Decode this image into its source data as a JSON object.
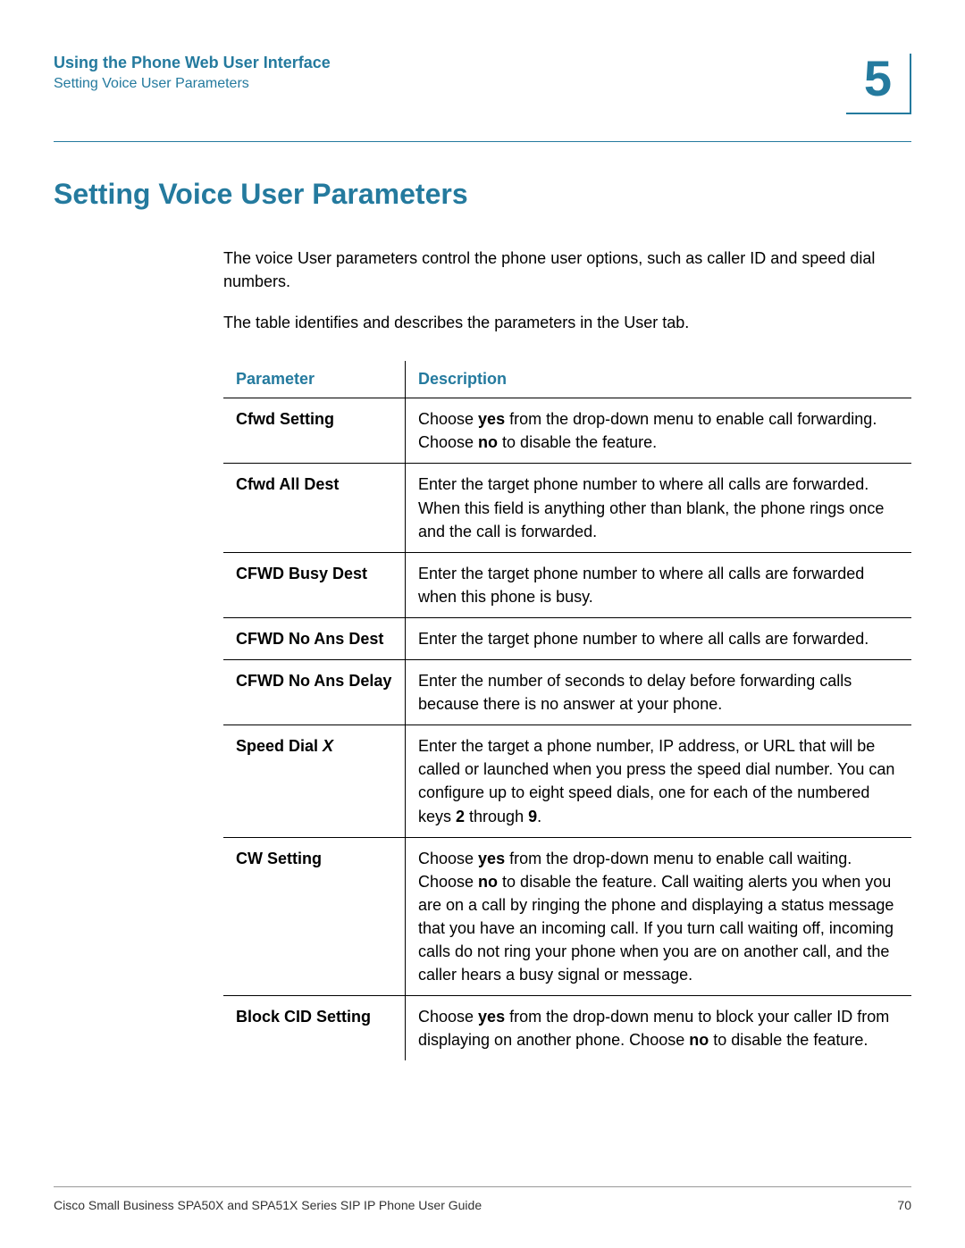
{
  "header": {
    "title": "Using the Phone Web User Interface",
    "subtitle": "Setting Voice User Parameters",
    "chapter": "5"
  },
  "main_heading": "Setting Voice User Parameters",
  "intro": {
    "p1": "The voice User parameters control the phone user options, such as caller ID and speed dial numbers.",
    "p2": "The table identifies and describes the parameters in the User tab."
  },
  "table": {
    "headers": {
      "col1": "Parameter",
      "col2": "Description"
    },
    "rows": [
      {
        "param": "Cfwd Setting",
        "desc_html": "Choose <b>yes</b> from the drop-down menu to enable call forwarding. Choose <b>no</b> to disable the feature."
      },
      {
        "param": "Cfwd All Dest",
        "desc_html": "Enter the target phone number to where all calls are forwarded. When this field is anything other than blank, the phone rings once and the call is forwarded."
      },
      {
        "param": "CFWD Busy Dest",
        "desc_html": "Enter the target phone number to where all calls are forwarded when this phone is busy."
      },
      {
        "param": "CFWD No Ans Dest",
        "desc_html": "Enter the target phone number to where all calls are forwarded."
      },
      {
        "param": "CFWD No Ans Delay",
        "desc_html": "Enter the number of seconds to delay before forwarding calls because there is no answer at your phone."
      },
      {
        "param_html": "Speed Dial <span class=\"italic\">X</span>",
        "desc_html": "Enter the target a phone number, IP address, or URL that will be called or launched when you press the speed dial number. You can configure up to eight speed dials, one for each of the numbered keys <b>2</b> through <b>9</b>."
      },
      {
        "param": "CW Setting",
        "desc_html": "Choose <b>yes</b> from the drop-down menu to enable call waiting. Choose <b>no</b> to disable the feature. Call waiting alerts you when you are on a call by ringing the phone and displaying a status message that you have an incoming call. If you turn call waiting off, incoming calls do not ring your phone when you are on another call, and the caller hears a busy signal or message."
      },
      {
        "param": "Block CID Setting",
        "desc_html": "Choose <b>yes</b> from the drop-down menu to block your caller ID from displaying on another phone. Choose <b>no</b> to disable the feature."
      }
    ]
  },
  "footer": {
    "left": "Cisco Small Business SPA50X and SPA51X Series SIP IP Phone User Guide",
    "right": "70"
  }
}
